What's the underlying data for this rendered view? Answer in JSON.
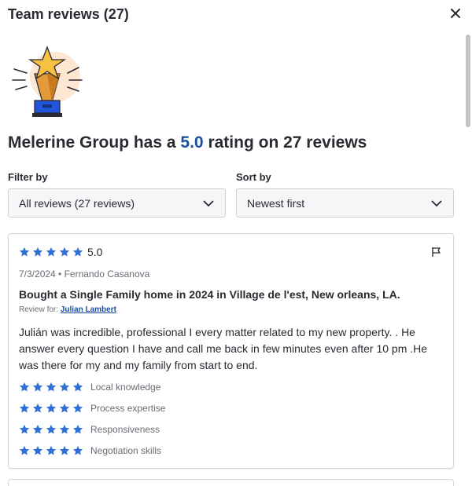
{
  "header": {
    "title": "Team reviews (27)"
  },
  "summary": {
    "prefix": "Melerine Group has a",
    "rating": "5.0",
    "suffix": "rating on 27 reviews"
  },
  "filters": {
    "filter_label": "Filter by",
    "filter_value": "All reviews (27 reviews)",
    "sort_label": "Sort by",
    "sort_value": "Newest first"
  },
  "review": {
    "star_count": 5,
    "score": "5.0",
    "meta": "7/3/2024 • Fernando Casanova",
    "title": "Bought a Single Family home in 2024 in Village de l'est, New orleans, LA.",
    "review_for_prefix": "Review for:",
    "review_for_agent": "Julian Lambert",
    "body": "Julián was incredible, professional I every matter related to my new property. . He answer every question I have and call me back in few minutes even after 10 pm .He was there for my and my family from start to end.",
    "sub_ratings": [
      {
        "label": "Local knowledge",
        "stars": 5
      },
      {
        "label": "Process expertise",
        "stars": 5
      },
      {
        "label": "Responsiveness",
        "stars": 5
      },
      {
        "label": "Negotiation skills",
        "stars": 5
      }
    ]
  },
  "colors": {
    "star": "#2f6fd6",
    "rating_accent": "#1a4e9e",
    "link": "#1a4e9e"
  },
  "icons": [
    "close-icon",
    "trophy-icon",
    "chevron-down-icon",
    "star-icon",
    "flag-icon"
  ]
}
